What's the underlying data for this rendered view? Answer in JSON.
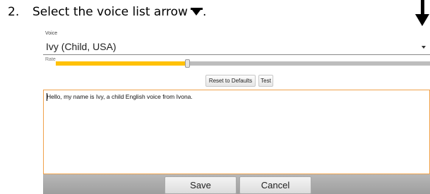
{
  "instruction": {
    "step_number": "2.",
    "text": "Select the voice list arrow",
    "period": "."
  },
  "voice": {
    "caption": "Voice",
    "selected": "Ivy (Child, USA)"
  },
  "rate": {
    "caption": "Rate",
    "level": 0.35
  },
  "buttons": {
    "reset_label": "Reset to Defaults",
    "test_label": "Test",
    "save_label": "Save",
    "cancel_label": "Cancel"
  },
  "text_field": {
    "value": "Hello, my name is Ivy, a child English voice from Ivona."
  },
  "colors": {
    "slider_fill": "#ffc107",
    "text_field_border": "#f0a24b"
  },
  "icons": {
    "inline_arrow": "dropdown-arrow-icon",
    "pointer": "down-arrow-pointer-icon"
  }
}
